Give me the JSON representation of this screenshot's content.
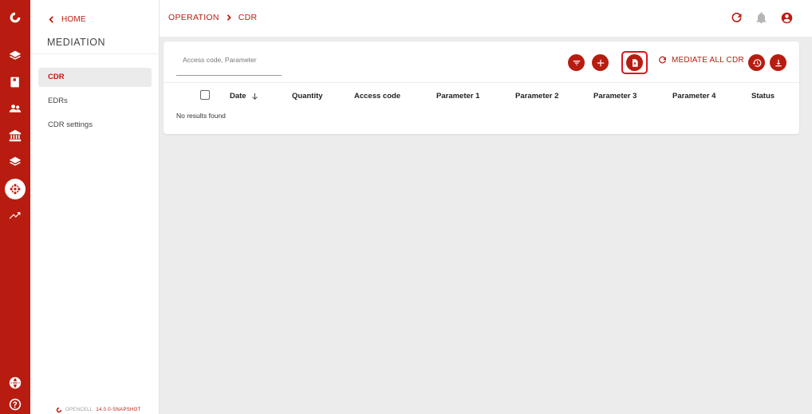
{
  "rail": {
    "icons": [
      "logo-icon",
      "layers-icon",
      "book-icon",
      "people-icon",
      "bank-icon",
      "stack-icon",
      "mediation-icon",
      "trending-icon",
      "globe-icon",
      "help-icon"
    ]
  },
  "subnav": {
    "home_label": "HOME",
    "module_title": "MEDIATION",
    "items": [
      {
        "label": "CDR",
        "active": true
      },
      {
        "label": "EDRs",
        "active": false
      },
      {
        "label": "CDR settings",
        "active": false
      }
    ],
    "footer_brand": "OPENCELL",
    "footer_version": "14.0.0-SNAPSHOT"
  },
  "topbar": {
    "breadcrumb": [
      "OPERATION",
      "CDR"
    ]
  },
  "toolbar": {
    "search_placeholder": "Access code, Parameter",
    "mediate_label": "MEDIATE ALL CDR"
  },
  "table": {
    "columns": [
      "Date",
      "Quantity",
      "Access code",
      "Parameter 1",
      "Parameter 2",
      "Parameter 3",
      "Parameter 4",
      "Status"
    ],
    "sorted_column": "Date",
    "empty_message": "No results found"
  },
  "colors": {
    "brand": "#b81c10",
    "highlight": "#e0141e"
  }
}
